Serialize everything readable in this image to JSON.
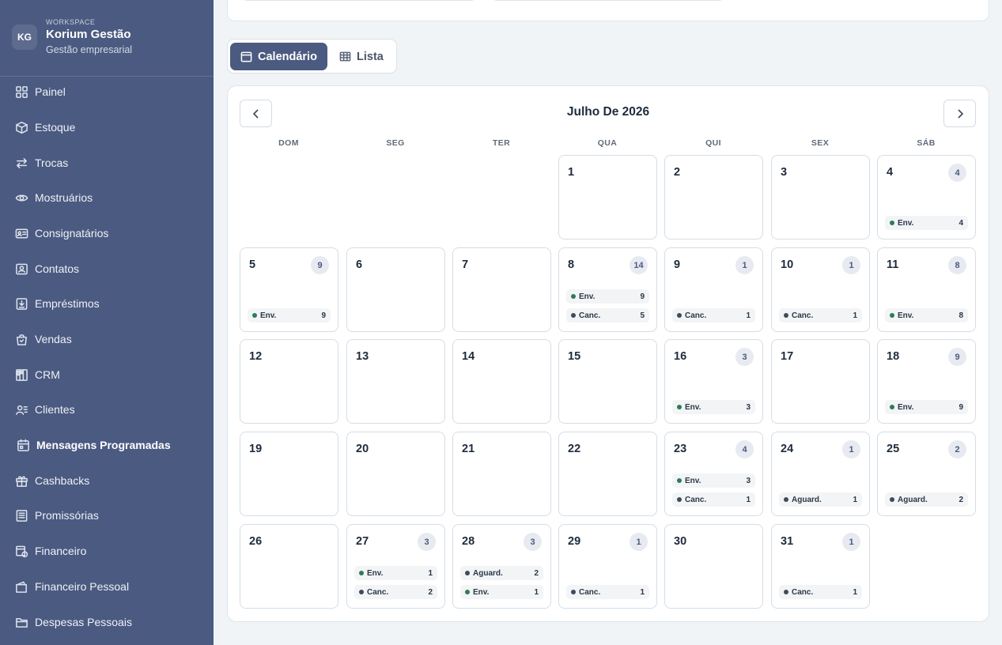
{
  "workspace": {
    "initials": "KG",
    "label": "WORKSPACE",
    "name": "Korium Gestão",
    "subtitle": "Gestão empresarial"
  },
  "sidebar": {
    "items": [
      {
        "label": "Painel",
        "icon": "grid-icon"
      },
      {
        "label": "Estoque",
        "icon": "box-icon"
      },
      {
        "label": "Trocas",
        "icon": "swap-icon"
      },
      {
        "label": "Mostruários",
        "icon": "eye-icon"
      },
      {
        "label": "Consignatários",
        "icon": "id-card-icon"
      },
      {
        "label": "Contatos",
        "icon": "contact-icon"
      },
      {
        "label": "Empréstimos",
        "icon": "loan-icon"
      },
      {
        "label": "Vendas",
        "icon": "bag-icon"
      },
      {
        "label": "CRM",
        "icon": "crm-icon"
      },
      {
        "label": "Clientes",
        "icon": "users-icon"
      },
      {
        "label": "Mensagens Programadas",
        "icon": "calendar-icon",
        "active": true
      },
      {
        "label": "Cashbacks",
        "icon": "gift-icon"
      },
      {
        "label": "Promissórias",
        "icon": "note-icon"
      },
      {
        "label": "Financeiro",
        "icon": "finance-icon"
      },
      {
        "label": "Financeiro Pessoal",
        "icon": "wallet-icon"
      },
      {
        "label": "Despesas Pessoais",
        "icon": "folder-icon"
      }
    ]
  },
  "view_toggle": {
    "calendar_label": "Calendário",
    "list_label": "Lista",
    "active": "calendar"
  },
  "calendar": {
    "month_title": "Julho De 2026",
    "weekdays": [
      "DOM",
      "SEG",
      "TER",
      "QUA",
      "QUI",
      "SEX",
      "SÁB"
    ],
    "first_weekday_index": 3,
    "days": [
      {
        "day": "1",
        "total": "",
        "events": []
      },
      {
        "day": "2",
        "total": "",
        "events": []
      },
      {
        "day": "3",
        "total": "",
        "events": []
      },
      {
        "day": "4",
        "total": "4",
        "events": [
          {
            "label": "Env.",
            "count": "4",
            "status": "sent"
          }
        ]
      },
      {
        "day": "5",
        "total": "9",
        "events": [
          {
            "label": "Env.",
            "count": "9",
            "status": "sent"
          }
        ]
      },
      {
        "day": "6",
        "total": "",
        "events": []
      },
      {
        "day": "7",
        "total": "",
        "events": []
      },
      {
        "day": "8",
        "total": "14",
        "events": [
          {
            "label": "Env.",
            "count": "9",
            "status": "sent"
          },
          {
            "label": "Canc.",
            "count": "5",
            "status": "canceled"
          }
        ]
      },
      {
        "day": "9",
        "total": "1",
        "events": [
          {
            "label": "Canc.",
            "count": "1",
            "status": "canceled"
          }
        ]
      },
      {
        "day": "10",
        "total": "1",
        "events": [
          {
            "label": "Canc.",
            "count": "1",
            "status": "canceled"
          }
        ]
      },
      {
        "day": "11",
        "total": "8",
        "events": [
          {
            "label": "Env.",
            "count": "8",
            "status": "sent"
          }
        ]
      },
      {
        "day": "12",
        "total": "",
        "events": []
      },
      {
        "day": "13",
        "total": "",
        "events": []
      },
      {
        "day": "14",
        "total": "",
        "events": []
      },
      {
        "day": "15",
        "total": "",
        "events": []
      },
      {
        "day": "16",
        "total": "3",
        "events": [
          {
            "label": "Env.",
            "count": "3",
            "status": "sent"
          }
        ]
      },
      {
        "day": "17",
        "total": "",
        "events": []
      },
      {
        "day": "18",
        "total": "9",
        "events": [
          {
            "label": "Env.",
            "count": "9",
            "status": "sent"
          }
        ]
      },
      {
        "day": "19",
        "total": "",
        "events": []
      },
      {
        "day": "20",
        "total": "",
        "events": []
      },
      {
        "day": "21",
        "total": "",
        "events": []
      },
      {
        "day": "22",
        "total": "",
        "events": []
      },
      {
        "day": "23",
        "total": "4",
        "events": [
          {
            "label": "Env.",
            "count": "3",
            "status": "sent"
          },
          {
            "label": "Canc.",
            "count": "1",
            "status": "canceled"
          }
        ]
      },
      {
        "day": "24",
        "total": "1",
        "events": [
          {
            "label": "Aguard.",
            "count": "1",
            "status": "waiting"
          }
        ]
      },
      {
        "day": "25",
        "total": "2",
        "events": [
          {
            "label": "Aguard.",
            "count": "2",
            "status": "waiting"
          }
        ]
      },
      {
        "day": "26",
        "total": "",
        "events": []
      },
      {
        "day": "27",
        "total": "3",
        "events": [
          {
            "label": "Env.",
            "count": "1",
            "status": "sent"
          },
          {
            "label": "Canc.",
            "count": "2",
            "status": "canceled"
          }
        ]
      },
      {
        "day": "28",
        "total": "3",
        "events": [
          {
            "label": "Aguard.",
            "count": "2",
            "status": "waiting"
          },
          {
            "label": "Env.",
            "count": "1",
            "status": "sent"
          }
        ]
      },
      {
        "day": "29",
        "total": "1",
        "events": [
          {
            "label": "Canc.",
            "count": "1",
            "status": "canceled"
          }
        ]
      },
      {
        "day": "30",
        "total": "",
        "events": []
      },
      {
        "day": "31",
        "total": "1",
        "events": [
          {
            "label": "Canc.",
            "count": "1",
            "status": "canceled"
          }
        ]
      }
    ]
  },
  "colors": {
    "sidebar": "#4b5a80",
    "accent": "#4b5a80",
    "sent": "#2f7a5a",
    "canceled": "#3f4a5c",
    "waiting": "#3f4a5c",
    "badge_bg": "#e7eaf0"
  }
}
